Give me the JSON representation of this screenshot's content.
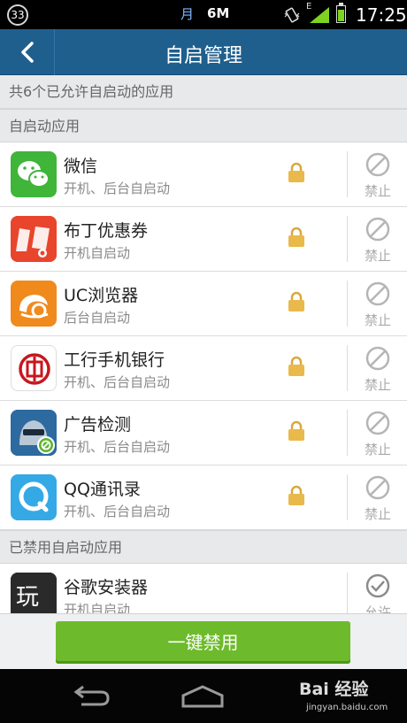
{
  "status_bar": {
    "notification_count": "33",
    "moon_glyph": "月",
    "data_speed": "6M",
    "network_type": "E",
    "battery_level": 0.7,
    "time": "17:25"
  },
  "header": {
    "title": "自启管理"
  },
  "summary": "共6个已允许自启动的应用",
  "sections": [
    {
      "title": "自启动应用",
      "apps": [
        {
          "name": "微信",
          "desc": "开机、后台自启动",
          "icon": "wechat-icon",
          "action": "禁止"
        },
        {
          "name": "布丁优惠券",
          "desc": "开机自启动",
          "icon": "budding-coupon-icon",
          "action": "禁止"
        },
        {
          "name": "UC浏览器",
          "desc": "后台自启动",
          "icon": "uc-browser-icon",
          "action": "禁止"
        },
        {
          "name": "工行手机银行",
          "desc": "开机、后台自启动",
          "icon": "icbc-bank-icon",
          "action": "禁止"
        },
        {
          "name": "广告检测",
          "desc": "开机、后台自启动",
          "icon": "ad-detect-icon",
          "action": "禁止"
        },
        {
          "name": "QQ通讯录",
          "desc": "开机、后台自启动",
          "icon": "qq-contacts-icon",
          "action": "禁止"
        }
      ]
    },
    {
      "title": "已禁用自启动应用",
      "apps": [
        {
          "name": "谷歌安装器",
          "desc": "开机自启动",
          "icon": "google-installer-icon",
          "action": "允许"
        }
      ]
    }
  ],
  "primary_action": "一键禁用",
  "watermark": {
    "brand": "Bai 经验",
    "url": "jingyan.baidu.com"
  },
  "colors": {
    "header": "#1f5f8d",
    "primary_button": "#6dbb2c",
    "lock": "#e9b94b"
  }
}
